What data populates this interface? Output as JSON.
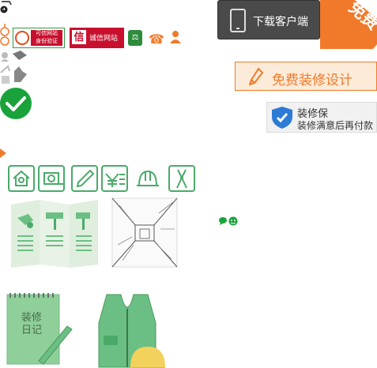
{
  "header": {
    "download_label": "下载客户端",
    "free_ribbon": "免费",
    "free_design_label": "免费装修设计"
  },
  "guarantee": {
    "title": "装修保",
    "subtitle": "装修满意后再付款"
  },
  "badges": {
    "trusted_site_top": "可信网站",
    "trusted_site_bottom": "身份验证",
    "xin_char": "信",
    "integrity_site": "诚信网站"
  },
  "diary": {
    "title_line1": "装修",
    "title_line2": "日记"
  },
  "colors": {
    "accent": "#f07a2a",
    "dark_button": "#4a4a4a",
    "green_icon": "#4aaa6a",
    "check_green": "#1aa33a",
    "shield_blue": "#2e7bd6",
    "badge_red": "#c8102e"
  },
  "icons": [
    "house-icon",
    "tape-measure-icon",
    "pencil-icon",
    "yuan-price-icon",
    "hard-hat-icon",
    "pliers-icon"
  ]
}
